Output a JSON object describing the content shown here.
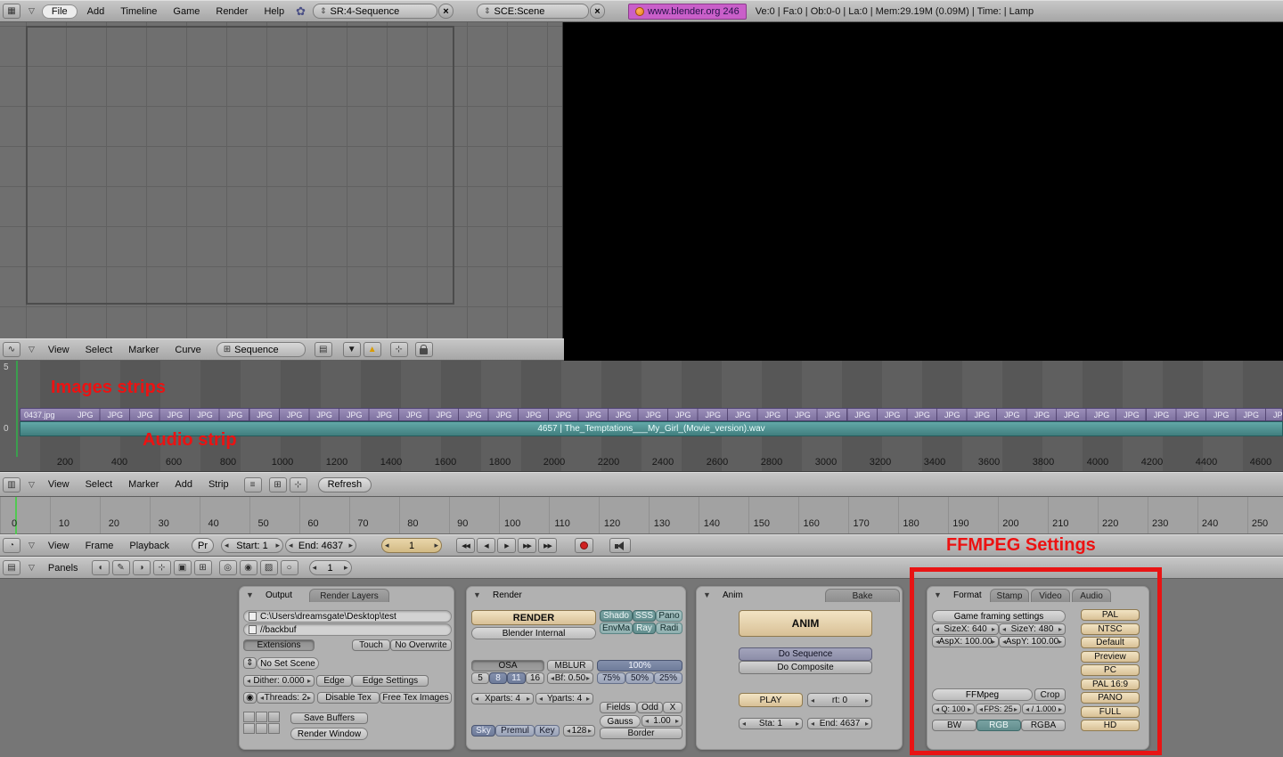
{
  "icons": {
    "grid": "▦",
    "tri": "▽",
    "tri_down": "▼",
    "flower": "✿",
    "updown": "⇕",
    "close": "×",
    "wave": "∿",
    "seq_grid": "⊞",
    "film": "▥",
    "list": "≡",
    "clock": "◔",
    "panel": "▤",
    "arrow_down": "▼",
    "arrow_up": "▲",
    "snap": "⊹",
    "globe": "◉",
    "jump_start": "◀◀",
    "frame_prev": "◀",
    "play": "▶",
    "frame_next": "▶▶",
    "jump_end": "▶▶",
    "context_logic": "◖",
    "context_script": "✎",
    "context_shading": "◑",
    "context_object": "⊹",
    "context_editing": "▣",
    "context_scene": "⊞",
    "sub_lamp": "◎",
    "sub_material": "◉",
    "sub_texture": "▨",
    "sub_world": "○"
  },
  "top_header": {
    "menus": [
      "File",
      "Add",
      "Timeline",
      "Game",
      "Render",
      "Help"
    ],
    "screen": "SR:4-Sequence",
    "scene": "SCE:Scene",
    "website": "www.blender.org 246",
    "stats": "Ve:0 | Fa:0 | Ob:0-0 | La:0 | Mem:29.19M (0.09M) | Time: | Lamp"
  },
  "preview_header": {
    "menus": [
      "View",
      "Select",
      "Marker",
      "Curve"
    ],
    "mode": "Sequence"
  },
  "strips": {
    "channel_top": "5",
    "channel_bottom": "0",
    "annotation_images": "Images strips",
    "annotation_audio": "Audio strip",
    "first_image_label": "0437.jpg",
    "image_label": "JPG",
    "image_repeat": 41,
    "audio_label": "4657 | The_Temptations___My_Girl_(Movie_version).wav",
    "ruler": {
      "start": 200,
      "end": 4600,
      "step": 200
    }
  },
  "vse_header": {
    "menus": [
      "View",
      "Select",
      "Marker",
      "Add",
      "Strip"
    ],
    "refresh": "Refresh"
  },
  "timeline": {
    "ruler": {
      "start": 0,
      "end": 250,
      "step": 10
    }
  },
  "timeline_header": {
    "menus": [
      "View",
      "Frame",
      "Playback"
    ],
    "pr": "Pr",
    "start": "Start: 1",
    "end": "End: 4637",
    "frame": "1",
    "annotation": "FFMPEG Settings"
  },
  "buttons_header": {
    "panels": "Panels",
    "frame": "1"
  },
  "panels": {
    "output": {
      "tabs": [
        "Output",
        "Render Layers"
      ],
      "path_field": "C:\\Users\\dreamsgate\\Desktop\\test",
      "backbuf_field": "//backbuf",
      "extensions": "Extensions",
      "touch": "Touch",
      "no_overwrite": "No Overwrite",
      "set_scene": "No Set Scene",
      "dither": "Dither: 0.000",
      "edge": "Edge",
      "edge_settings": "Edge Settings",
      "threads": "Threads: 2",
      "disable_tex": "Disable Tex",
      "free_tex": "Free Tex Images",
      "save_buffers": "Save Buffers",
      "render_window": "Render Window"
    },
    "render": {
      "tabs": [
        "Render"
      ],
      "render_button": "RENDER",
      "engine": "Blender Internal",
      "toggles_row1": [
        "Shado",
        "SSS",
        "Pano"
      ],
      "toggles_row2": [
        "EnvMa",
        "Ray",
        "Radi"
      ],
      "osa": "OSA",
      "os_values_note": "",
      "osa_values": [
        "5",
        "8",
        "11",
        "16"
      ],
      "mblur": "MBLUR",
      "bf": "Bf: 0.50",
      "size_100": "100%",
      "sizes": [
        "75%",
        "50%",
        "25%"
      ],
      "xparts": "Xparts: 4",
      "yparts": "Yparts: 4",
      "fields": "Fields",
      "odd": "Odd",
      "x": "X",
      "filter": "Gauss",
      "filter_size": "1.00",
      "sky": "Sky",
      "premul": "Premul",
      "key": "Key",
      "quality": "128",
      "border": "Border"
    },
    "anim": {
      "tabs": [
        "Anim",
        "Bake"
      ],
      "anim_button": "ANIM",
      "do_sequence": "Do Sequence",
      "do_composite": "Do Composite",
      "play": "PLAY",
      "rt": "rt: 0",
      "sta": "Sta: 1",
      "end": "End: 4637"
    },
    "format": {
      "tabs": [
        "Format",
        "Stamp",
        "Video",
        "Audio"
      ],
      "game_framing": "Game framing settings",
      "sizex": "SizeX: 640",
      "sizey": "SizeY: 480",
      "aspx": "AspX: 100.00",
      "aspy": "AspY: 100.00",
      "codec": "FFMpeg",
      "crop": "Crop",
      "q": "Q: 100",
      "fps": "FPS: 25",
      "fps_base": "/ 1.000",
      "bw": "BW",
      "rgb": "RGB",
      "rgba": "RGBA",
      "presets": [
        "PAL",
        "NTSC",
        "Default",
        "Preview",
        "PC",
        "PAL 16:9",
        "PANO",
        "FULL",
        "HD"
      ]
    }
  }
}
